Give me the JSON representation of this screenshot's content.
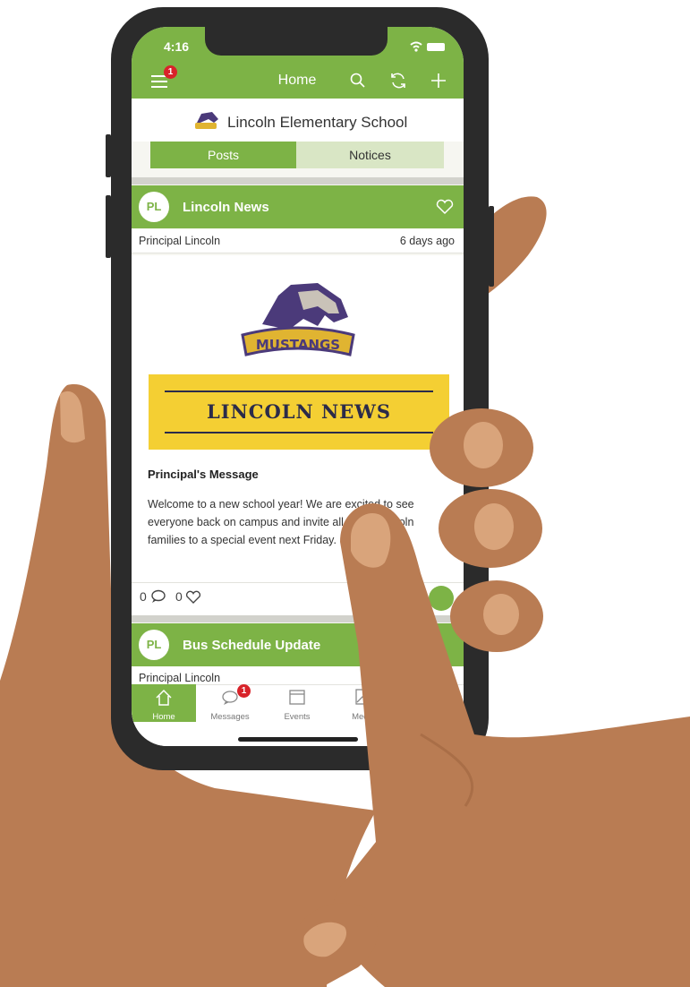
{
  "status_bar": {
    "time": "4:16"
  },
  "top_bar": {
    "title": "Home",
    "menu_badge": "1"
  },
  "school": {
    "name": "Lincoln Elementary School"
  },
  "segments": {
    "posts": "Posts",
    "notices": "Notices"
  },
  "posts": [
    {
      "avatar": "PL",
      "title": "Lincoln News",
      "author": "Principal Lincoln",
      "time": "6 days ago",
      "logo_text": "MUSTANGS",
      "banner_text": "LINCOLN NEWS",
      "subtitle": "Principal's Message",
      "excerpt": "Welcome to a new school year! We are excited to see everyone back on campus and invite all of our Lincoln families to a special event next Friday.",
      "comment_count": "0",
      "like_count": "0"
    },
    {
      "avatar": "PL",
      "title": "Bus Schedule Update",
      "author": "Principal Lincoln"
    }
  ],
  "tabs": {
    "home": "Home",
    "messages": "Messages",
    "messages_badge": "1",
    "events": "Events",
    "media": "Media"
  },
  "colors": {
    "brand": "#7db346",
    "brand_light": "#d9e6c5",
    "badge": "#d8232a",
    "skin": "#b97c53",
    "skin_light": "#d9a47b",
    "phone": "#2b2b2b"
  },
  "icons": [
    "menu-icon",
    "search-icon",
    "refresh-icon",
    "plus-icon",
    "heart-icon",
    "comment-icon",
    "wave-icon",
    "home-icon",
    "messages-icon",
    "calendar-icon",
    "media-icon",
    "wifi-icon",
    "battery-icon"
  ]
}
